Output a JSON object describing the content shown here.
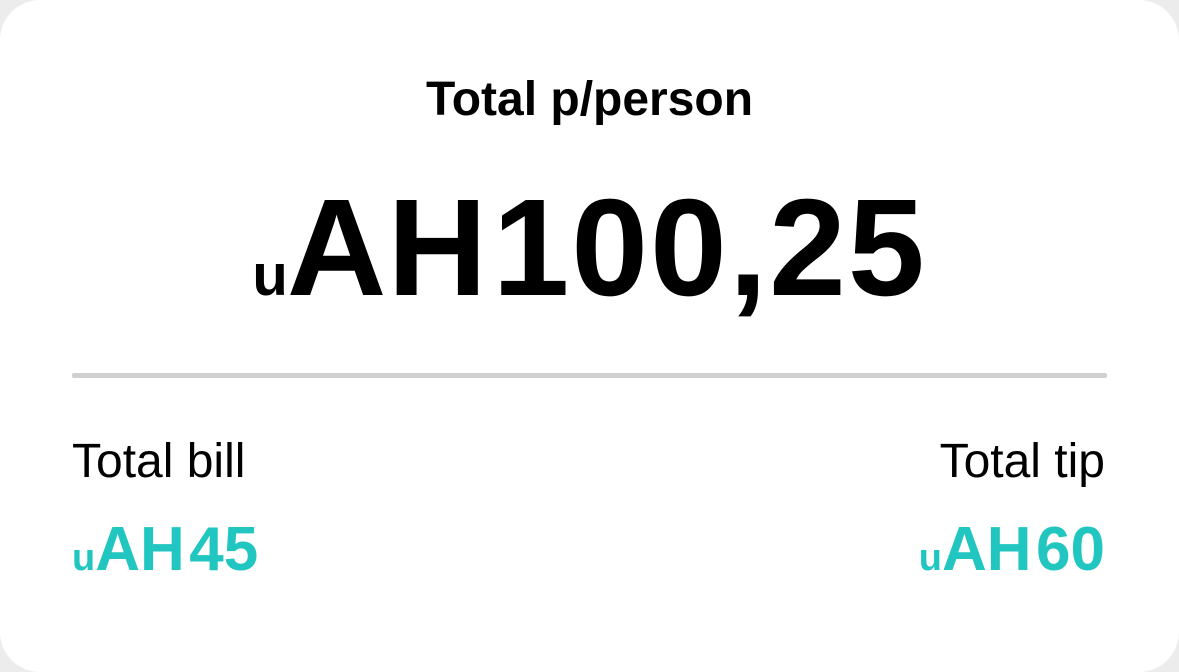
{
  "summary": {
    "title": "Total p/person",
    "per_person": {
      "currency_small": "u",
      "currency_big": "AH",
      "amount": "100,25"
    },
    "bill": {
      "label": "Total bill",
      "currency_small": "u",
      "currency_big": "AH",
      "amount": "45"
    },
    "tip": {
      "label": "Total tip",
      "currency_small": "u",
      "currency_big": "AH",
      "amount": "60"
    }
  },
  "colors": {
    "accent": "#21c6c0",
    "text": "#000000",
    "divider": "#d0d0d0",
    "card": "#ffffff"
  }
}
